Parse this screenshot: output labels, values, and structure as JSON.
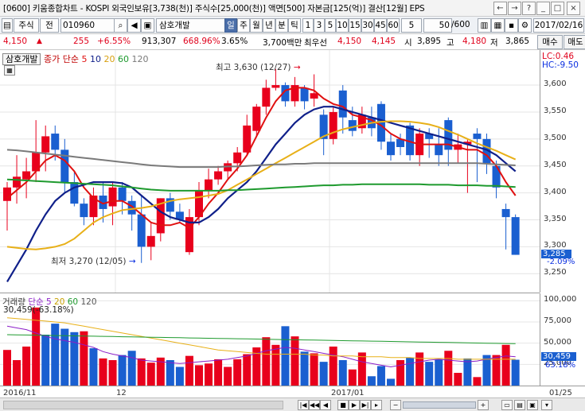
{
  "title": "[0600] 키움종합차트 - KOSPI 외국인보유[3,738(천)] 주식수[25,000(천)] 액면[500] 자본금[125(억)] 결산[12월] EPS",
  "window_buttons": [
    "←",
    "→",
    "?",
    "_",
    "□",
    "×"
  ],
  "toolbar": {
    "market": "주식",
    "all_label": "전",
    "code": "010960",
    "stock_name": "삼호개발",
    "periods": [
      "일",
      "주",
      "월",
      "년",
      "분",
      "틱"
    ],
    "minutes": [
      "1",
      "3",
      "5",
      "10",
      "15",
      "30",
      "45",
      "60"
    ],
    "minute_select": "5",
    "count": "50",
    "count_total": "/600",
    "date": "2017/02/16"
  },
  "quote": {
    "price": "4,150",
    "arrow": "▲",
    "change": "255",
    "change_pct": "+6.55%",
    "volume": "913,307",
    "vol_ratio": "668.96%",
    "turnover": "3.65%",
    "amount": "3,700백만",
    "pref_name": "최우선",
    "ask": "4,150",
    "bid": "4,145",
    "open_label": "시",
    "open": "3,895",
    "high_label": "고",
    "high": "4,180",
    "low_label": "저",
    "low": "3,865",
    "buy_label": "매수",
    "sell_label": "매도"
  },
  "price_legend": {
    "name": "삼호개발",
    "ma_label": "종가 단순",
    "ma_periods": [
      "5",
      "10",
      "20",
      "60",
      "120"
    ],
    "lc": "LC:0.46",
    "hc": "HC:-9.50"
  },
  "annotations": {
    "high": "최고 3,630 (12/27)",
    "low": "최저 3,270 (12/05)"
  },
  "last_price_tag": "3,285",
  "last_price_pct": "-2.09%",
  "vol_legend": {
    "name": "거래량",
    "ma_label": "단순",
    "ma_periods": [
      "5",
      "20",
      "60",
      "120"
    ],
    "current": "30,459(-63.18%)"
  },
  "vol_tag": "30,459",
  "vol_tag_pct": "63.18%",
  "colors": {
    "up": "#e8001c",
    "down": "#1a5fd0",
    "ma5": "#e01010",
    "ma10": "#10208a",
    "ma20": "#e8b018",
    "ma60": "#1e9a2e",
    "ma120": "#7a7a7a",
    "vol5": "#8b1ec8"
  },
  "chart_data": [
    {
      "type": "candlestick",
      "title": "삼호개발",
      "yticks": [
        3600,
        3550,
        3500,
        3450,
        3400,
        3350,
        3300,
        3250
      ],
      "ylim": [
        3215,
        3665
      ],
      "xticks": [
        "2016/11",
        "12",
        "2017/01",
        "01/25"
      ],
      "candles": [
        {
          "o": 3385,
          "h": 3420,
          "l": 3330,
          "c": 3410
        },
        {
          "o": 3410,
          "h": 3470,
          "l": 3380,
          "c": 3430
        },
        {
          "o": 3425,
          "h": 3465,
          "l": 3390,
          "c": 3440
        },
        {
          "o": 3440,
          "h": 3535,
          "l": 3420,
          "c": 3475
        },
        {
          "o": 3475,
          "h": 3525,
          "l": 3440,
          "c": 3505
        },
        {
          "o": 3510,
          "h": 3525,
          "l": 3460,
          "c": 3480
        },
        {
          "o": 3480,
          "h": 3500,
          "l": 3400,
          "c": 3420
        },
        {
          "o": 3420,
          "h": 3440,
          "l": 3375,
          "c": 3380
        },
        {
          "o": 3380,
          "h": 3390,
          "l": 3340,
          "c": 3355
        },
        {
          "o": 3355,
          "h": 3410,
          "l": 3340,
          "c": 3395
        },
        {
          "o": 3395,
          "h": 3420,
          "l": 3345,
          "c": 3370
        },
        {
          "o": 3375,
          "h": 3420,
          "l": 3340,
          "c": 3410
        },
        {
          "o": 3410,
          "h": 3420,
          "l": 3360,
          "c": 3385
        },
        {
          "o": 3385,
          "h": 3395,
          "l": 3330,
          "c": 3360
        },
        {
          "o": 3360,
          "h": 3395,
          "l": 3270,
          "c": 3300
        },
        {
          "o": 3300,
          "h": 3345,
          "l": 3275,
          "c": 3320
        },
        {
          "o": 3325,
          "h": 3390,
          "l": 3310,
          "c": 3390
        },
        {
          "o": 3390,
          "h": 3400,
          "l": 3350,
          "c": 3365
        },
        {
          "o": 3365,
          "h": 3380,
          "l": 3345,
          "c": 3350
        },
        {
          "o": 3290,
          "h": 3370,
          "l": 3285,
          "c": 3355
        },
        {
          "o": 3355,
          "h": 3420,
          "l": 3340,
          "c": 3405
        },
        {
          "o": 3405,
          "h": 3445,
          "l": 3390,
          "c": 3425
        },
        {
          "o": 3425,
          "h": 3450,
          "l": 3415,
          "c": 3440
        },
        {
          "o": 3440,
          "h": 3460,
          "l": 3425,
          "c": 3455
        },
        {
          "o": 3455,
          "h": 3485,
          "l": 3440,
          "c": 3475
        },
        {
          "o": 3475,
          "h": 3545,
          "l": 3470,
          "c": 3525
        },
        {
          "o": 3515,
          "h": 3565,
          "l": 3505,
          "c": 3560
        },
        {
          "o": 3560,
          "h": 3610,
          "l": 3545,
          "c": 3595
        },
        {
          "o": 3595,
          "h": 3630,
          "l": 3590,
          "c": 3600
        },
        {
          "o": 3600,
          "h": 3605,
          "l": 3560,
          "c": 3570
        },
        {
          "o": 3570,
          "h": 3615,
          "l": 3560,
          "c": 3600
        },
        {
          "o": 3595,
          "h": 3600,
          "l": 3555,
          "c": 3570
        },
        {
          "o": 3575,
          "h": 3620,
          "l": 3560,
          "c": 3585
        },
        {
          "o": 3545,
          "h": 3555,
          "l": 3470,
          "c": 3500
        },
        {
          "o": 3500,
          "h": 3560,
          "l": 3490,
          "c": 3550
        },
        {
          "o": 3590,
          "h": 3600,
          "l": 3510,
          "c": 3540
        },
        {
          "o": 3535,
          "h": 3560,
          "l": 3505,
          "c": 3515
        },
        {
          "o": 3520,
          "h": 3560,
          "l": 3510,
          "c": 3545
        },
        {
          "o": 3540,
          "h": 3560,
          "l": 3505,
          "c": 3520
        },
        {
          "o": 3565,
          "h": 3570,
          "l": 3480,
          "c": 3495
        },
        {
          "o": 3495,
          "h": 3510,
          "l": 3460,
          "c": 3470
        },
        {
          "o": 3500,
          "h": 3510,
          "l": 3470,
          "c": 3485
        },
        {
          "o": 3525,
          "h": 3530,
          "l": 3460,
          "c": 3470
        },
        {
          "o": 3470,
          "h": 3520,
          "l": 3450,
          "c": 3510
        },
        {
          "o": 3510,
          "h": 3520,
          "l": 3465,
          "c": 3500
        },
        {
          "o": 3490,
          "h": 3520,
          "l": 3450,
          "c": 3470
        },
        {
          "o": 3535,
          "h": 3540,
          "l": 3450,
          "c": 3480
        },
        {
          "o": 3480,
          "h": 3510,
          "l": 3455,
          "c": 3490
        },
        {
          "o": 3490,
          "h": 3500,
          "l": 3400,
          "c": 3495
        },
        {
          "o": 3510,
          "h": 3520,
          "l": 3420,
          "c": 3500
        },
        {
          "o": 3500,
          "h": 3510,
          "l": 3435,
          "c": 3455
        },
        {
          "o": 3450,
          "h": 3460,
          "l": 3390,
          "c": 3410
        },
        {
          "o": 3370,
          "h": 3380,
          "l": 3295,
          "c": 3355
        },
        {
          "o": 3355,
          "h": 3360,
          "l": 3285,
          "c": 3285
        }
      ],
      "series": [
        {
          "name": "5",
          "values": [
            3390,
            3405,
            3420,
            3440,
            3460,
            3470,
            3460,
            3440,
            3410,
            3390,
            3380,
            3385,
            3385,
            3375,
            3360,
            3345,
            3340,
            3340,
            3345,
            3335,
            3355,
            3380,
            3400,
            3425,
            3445,
            3470,
            3505,
            3540,
            3570,
            3590,
            3595,
            3595,
            3590,
            3575,
            3565,
            3560,
            3545,
            3540,
            3535,
            3525,
            3510,
            3500,
            3495,
            3490,
            3490,
            3490,
            3490,
            3485,
            3480,
            3480,
            3470,
            3450,
            3420,
            3395
          ]
        },
        {
          "name": "10",
          "values": [
            3235,
            3265,
            3295,
            3330,
            3360,
            3385,
            3400,
            3410,
            3415,
            3420,
            3420,
            3420,
            3418,
            3410,
            3395,
            3380,
            3365,
            3355,
            3350,
            3345,
            3345,
            3355,
            3370,
            3390,
            3405,
            3420,
            3440,
            3465,
            3490,
            3510,
            3530,
            3545,
            3555,
            3560,
            3560,
            3555,
            3550,
            3545,
            3540,
            3535,
            3530,
            3525,
            3520,
            3515,
            3510,
            3505,
            3500,
            3495,
            3490,
            3485,
            3480,
            3470,
            3455,
            3440
          ]
        },
        {
          "name": "20",
          "values": [
            3300,
            3298,
            3296,
            3295,
            3297,
            3300,
            3305,
            3315,
            3330,
            3345,
            3355,
            3362,
            3368,
            3370,
            3372,
            3375,
            3380,
            3385,
            3388,
            3390,
            3392,
            3395,
            3398,
            3405,
            3415,
            3425,
            3435,
            3445,
            3455,
            3465,
            3475,
            3485,
            3495,
            3505,
            3512,
            3518,
            3522,
            3526,
            3530,
            3532,
            3533,
            3533,
            3532,
            3530,
            3527,
            3522,
            3515,
            3508,
            3500,
            3492,
            3485,
            3478,
            3470,
            3462
          ]
        },
        {
          "name": "60",
          "values": [
            3425,
            3424,
            3423,
            3422,
            3421,
            3420,
            3419,
            3418,
            3417,
            3416,
            3415,
            3414,
            3412,
            3410,
            3408,
            3406,
            3405,
            3404,
            3404,
            3404,
            3404,
            3404,
            3404,
            3405,
            3405,
            3406,
            3407,
            3408,
            3409,
            3410,
            3411,
            3412,
            3413,
            3414,
            3414,
            3415,
            3415,
            3416,
            3416,
            3416,
            3416,
            3416,
            3416,
            3416,
            3415,
            3415,
            3415,
            3414,
            3414,
            3414,
            3413,
            3413,
            3412,
            3411
          ]
        },
        {
          "name": "120",
          "values": [
            3480,
            3479,
            3477,
            3475,
            3473,
            3471,
            3469,
            3467,
            3465,
            3463,
            3461,
            3459,
            3457,
            3455,
            3453,
            3451,
            3450,
            3449,
            3448,
            3448,
            3448,
            3448,
            3448,
            3449,
            3449,
            3450,
            3451,
            3452,
            3453,
            3453,
            3454,
            3454,
            3455,
            3455,
            3455,
            3455,
            3455,
            3455,
            3455,
            3455,
            3455,
            3455,
            3455,
            3455,
            3455,
            3455,
            3455,
            3455,
            3455,
            3455,
            3454,
            3453,
            3452,
            3451
          ]
        }
      ]
    },
    {
      "type": "bar",
      "title": "거래량",
      "yticks": [
        100000,
        75000,
        50000,
        25000
      ],
      "ylim": [
        0,
        105000
      ],
      "values": [
        42000,
        30000,
        46000,
        92000,
        60000,
        73000,
        67000,
        63000,
        64000,
        44000,
        32000,
        30000,
        36000,
        41000,
        32000,
        27000,
        33000,
        30000,
        22000,
        35000,
        24000,
        26000,
        31000,
        22000,
        31000,
        37000,
        45000,
        57000,
        48000,
        70000,
        58000,
        40000,
        38000,
        28000,
        46000,
        30000,
        19000,
        39000,
        11000,
        23000,
        8000,
        30000,
        33000,
        39000,
        28000,
        31000,
        41000,
        15000,
        32000,
        10000,
        36000,
        36000,
        48000,
        30459
      ],
      "up": [
        1,
        1,
        1,
        1,
        0,
        0,
        0,
        0,
        1,
        0,
        1,
        1,
        0,
        0,
        1,
        1,
        1,
        0,
        0,
        1,
        1,
        1,
        1,
        1,
        1,
        1,
        1,
        1,
        1,
        0,
        1,
        0,
        1,
        0,
        1,
        0,
        1,
        1,
        0,
        0,
        0,
        1,
        0,
        1,
        0,
        0,
        1,
        1,
        0,
        1,
        0,
        1,
        1,
        0
      ],
      "series": [
        {
          "name": "5",
          "values": [
            70000,
            68000,
            66000,
            62000,
            58000,
            55000,
            53000,
            51000,
            48000,
            45000,
            40000,
            37000,
            35000,
            33000,
            30000,
            29000,
            28000,
            27000,
            26000,
            27000,
            28000,
            29000,
            30000,
            31000,
            33000,
            35000,
            38000,
            41000,
            43000,
            45000,
            44000,
            42000,
            40000,
            38000,
            36000,
            34000,
            31000,
            28000,
            26000,
            24000,
            22000,
            24000,
            26000,
            28000,
            30000,
            31000,
            30000,
            29000,
            28000,
            29000,
            31000,
            33000,
            35000,
            34000
          ]
        },
        {
          "name": "20",
          "values": [
            80000,
            79000,
            78000,
            77000,
            76000,
            75000,
            74000,
            72000,
            70000,
            68000,
            66000,
            64000,
            62000,
            60000,
            58000,
            56000,
            54000,
            52000,
            50000,
            48000,
            46000,
            44000,
            42000,
            41000,
            40000,
            39000,
            38000,
            37000,
            37000,
            37000,
            37000,
            37000,
            36000,
            36000,
            35000,
            35000,
            35000,
            34000,
            34000,
            34000,
            33000,
            33000,
            33000,
            32000,
            32000,
            32000,
            32000,
            31000,
            31000,
            31000,
            31000,
            31000,
            31000,
            31000
          ]
        },
        {
          "name": "60",
          "values": [
            60000,
            59800,
            59600,
            59400,
            59200,
            59000,
            58800,
            58600,
            58400,
            58200,
            58000,
            57800,
            57600,
            57400,
            57200,
            57000,
            56800,
            56600,
            56400,
            56200,
            56000,
            55800,
            55600,
            55400,
            55200,
            55000,
            54800,
            54600,
            54400,
            54200,
            54000,
            53800,
            53600,
            53400,
            53200,
            53000,
            52800,
            52600,
            52400,
            52200,
            52000,
            51800,
            51600,
            51400,
            51200,
            51000,
            50800,
            50600,
            50400,
            50200,
            50000,
            49800,
            49600,
            49400
          ]
        }
      ]
    }
  ]
}
